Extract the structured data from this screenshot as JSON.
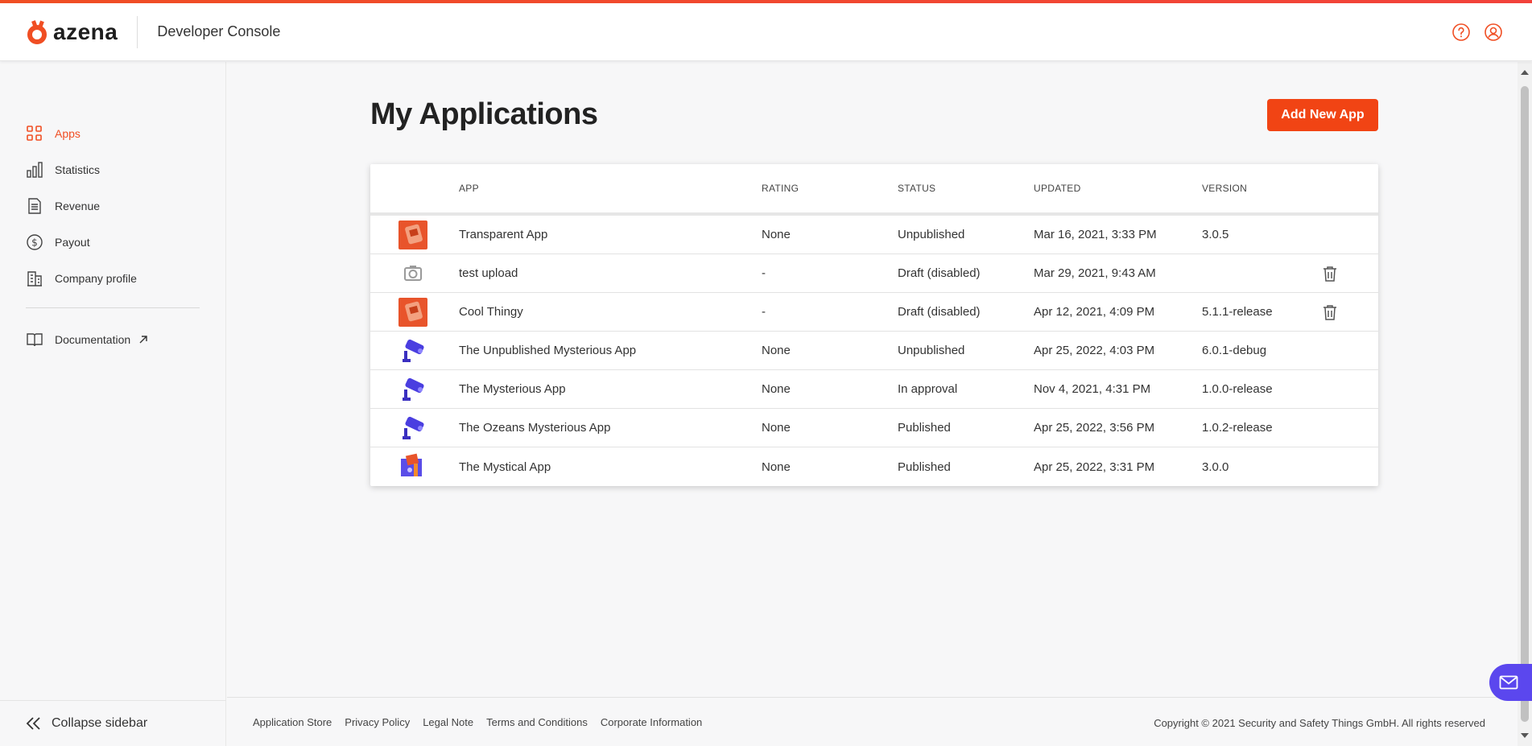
{
  "colors": {
    "accent": "#f04e23",
    "button": "#f14414",
    "fab": "#5b47ee"
  },
  "header": {
    "brand": "azena",
    "title": "Developer Console",
    "icons": [
      "help-icon",
      "user-icon"
    ]
  },
  "sidebar": {
    "items": [
      {
        "label": "Apps",
        "icon": "apps-grid-icon",
        "active": true
      },
      {
        "label": "Statistics",
        "icon": "bar-chart-icon"
      },
      {
        "label": "Revenue",
        "icon": "document-icon"
      },
      {
        "label": "Payout",
        "icon": "dollar-circle-icon"
      },
      {
        "label": "Company profile",
        "icon": "building-icon"
      }
    ],
    "documentation": {
      "label": "Documentation",
      "icon": "book-icon"
    },
    "collapse_label": "Collapse sidebar"
  },
  "main": {
    "title": "My Applications",
    "add_button": "Add New App",
    "table": {
      "headers": [
        "App",
        "Rating",
        "Status",
        "Updated",
        "Version"
      ],
      "rows": [
        {
          "thumb": "orange",
          "app": "Transparent App",
          "rating": "None",
          "status": "Unpublished",
          "updated": "Mar 16, 2021, 3:33 PM",
          "version": "3.0.5",
          "deletable": false
        },
        {
          "thumb": "camera",
          "app": "test upload",
          "rating": "-",
          "status": "Draft (disabled)",
          "updated": "Mar 29, 2021, 9:43 AM",
          "version": "",
          "deletable": true
        },
        {
          "thumb": "orange",
          "app": "Cool Thingy",
          "rating": "-",
          "status": "Draft (disabled)",
          "updated": "Apr 12, 2021, 4:09 PM",
          "version": "5.1.1-release",
          "deletable": true
        },
        {
          "thumb": "purple",
          "app": "The Unpublished Mysterious App",
          "rating": "None",
          "status": "Unpublished",
          "updated": "Apr 25, 2022, 4:03 PM",
          "version": "6.0.1-debug",
          "deletable": false
        },
        {
          "thumb": "purple",
          "app": "The Mysterious App",
          "rating": "None",
          "status": "In approval",
          "updated": "Nov 4, 2021, 4:31 PM",
          "version": "1.0.0-release",
          "deletable": false
        },
        {
          "thumb": "purple",
          "app": "The Ozeans Mysterious App",
          "rating": "None",
          "status": "Published",
          "updated": "Apr 25, 2022, 3:56 PM",
          "version": "1.0.2-release",
          "deletable": false
        },
        {
          "thumb": "mixed",
          "app": "The Mystical App",
          "rating": "None",
          "status": "Published",
          "updated": "Apr 25, 2022, 3:31 PM",
          "version": "3.0.0",
          "deletable": false
        }
      ]
    }
  },
  "footer": {
    "links": [
      "Application Store",
      "Privacy Policy",
      "Legal Note",
      "Terms and Conditions",
      "Corporate Information"
    ],
    "copyright": "Copyright © 2021 Security and Safety Things GmbH. All rights reserved"
  }
}
